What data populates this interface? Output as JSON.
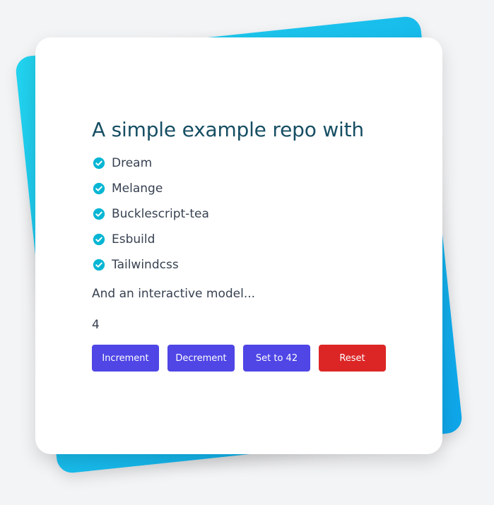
{
  "card": {
    "title": "A simple example repo with",
    "features": [
      {
        "label": "Dream",
        "icon": "check-circle-icon"
      },
      {
        "label": "Melange",
        "icon": "check-circle-icon"
      },
      {
        "label": "Bucklescript-tea",
        "icon": "check-circle-icon"
      },
      {
        "label": "Esbuild",
        "icon": "check-circle-icon"
      },
      {
        "label": "Tailwindcss",
        "icon": "check-circle-icon"
      }
    ],
    "subtitle": "And an interactive model...",
    "counter_value": "4",
    "buttons": {
      "increment": "Increment",
      "decrement": "Decrement",
      "set42": "Set to 42",
      "reset": "Reset"
    }
  },
  "colors": {
    "accent": "#06b6d4",
    "title": "#164e63",
    "primary_button": "#4f46e5",
    "danger_button": "#dc2626",
    "backdrop_start": "#22d3ee",
    "backdrop_end": "#0ea5e9"
  }
}
